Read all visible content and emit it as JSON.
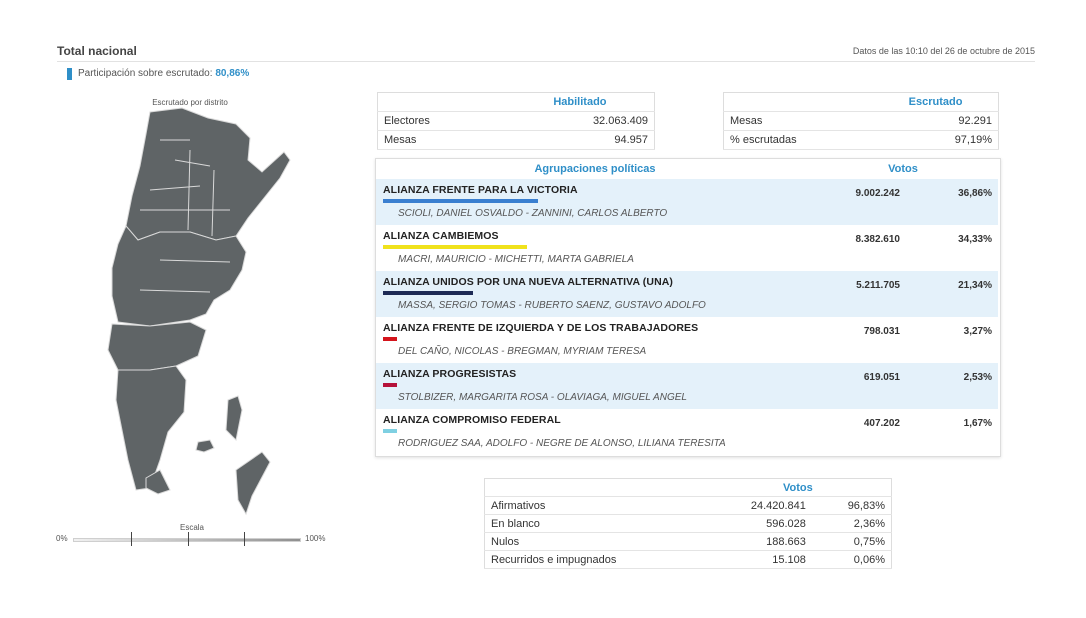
{
  "header": {
    "title": "Total nacional",
    "date": "Datos de las 10:10 del 26 de octubre de 2015"
  },
  "participation": {
    "label": "Participación sobre escrutado:",
    "value": "80,86%",
    "accent": "#2f8fc8"
  },
  "map": {
    "caption": "Escrutado por distrito",
    "fill_color": "#5f6466",
    "scale_label": "Escala",
    "scale_min": "0%",
    "scale_max": "100%"
  },
  "habilitado": {
    "header": "Habilitado",
    "rows": [
      {
        "label": "Electores",
        "value": "32.063.409"
      },
      {
        "label": "Mesas",
        "value": "94.957"
      }
    ]
  },
  "escrutado": {
    "header": "Escrutado",
    "rows": [
      {
        "label": "Mesas",
        "value": "92.291"
      },
      {
        "label": "% escrutadas",
        "value": "97,19%"
      }
    ]
  },
  "parties": {
    "header_name": "Agrupaciones políticas",
    "header_votes": "Votos",
    "items": [
      {
        "name": "ALIANZA FRENTE PARA LA VICTORIA",
        "candidates": "SCIOLI, DANIEL OSVALDO - ZANNINI, CARLOS ALBERTO",
        "votes": "9.002.242",
        "pct": "36,86%",
        "color": "#3a7fd0",
        "share": 0.3686
      },
      {
        "name": "ALIANZA CAMBIEMOS",
        "candidates": "MACRI, MAURICIO - MICHETTI, MARTA GABRIELA",
        "votes": "8.382.610",
        "pct": "34,33%",
        "color": "#f0e21c",
        "share": 0.3433
      },
      {
        "name": "ALIANZA UNIDOS POR UNA NUEVA ALTERNATIVA (UNA)",
        "candidates": "MASSA, SERGIO TOMAS - RUBERTO SAENZ, GUSTAVO ADOLFO",
        "votes": "5.211.705",
        "pct": "21,34%",
        "color": "#1d2a55",
        "share": 0.2134
      },
      {
        "name": "ALIANZA FRENTE DE IZQUIERDA Y DE LOS TRABAJADORES",
        "candidates": "DEL CAÑO, NICOLAS - BREGMAN, MYRIAM TERESA",
        "votes": "798.031",
        "pct": "3,27%",
        "color": "#d4141c",
        "share": 0.0327
      },
      {
        "name": "ALIANZA PROGRESISTAS",
        "candidates": "STOLBIZER, MARGARITA ROSA - OLAVIAGA, MIGUEL ANGEL",
        "votes": "619.051",
        "pct": "2,53%",
        "color": "#b5123a",
        "share": 0.0253
      },
      {
        "name": "ALIANZA COMPROMISO FEDERAL",
        "candidates": "RODRIGUEZ SAA, ADOLFO - NEGRE DE ALONSO, LILIANA TERESITA",
        "votes": "407.202",
        "pct": "1,67%",
        "color": "#7fd0e2",
        "share": 0.0167
      }
    ]
  },
  "summary": {
    "header": "Votos",
    "rows": [
      {
        "label": "Afirmativos",
        "value": "24.420.841",
        "pct": "96,83%"
      },
      {
        "label": "En blanco",
        "value": "596.028",
        "pct": "2,36%"
      },
      {
        "label": "Nulos",
        "value": "188.663",
        "pct": "0,75%"
      },
      {
        "label": "Recurridos e impugnados",
        "value": "15.108",
        "pct": "0,06%"
      }
    ]
  }
}
